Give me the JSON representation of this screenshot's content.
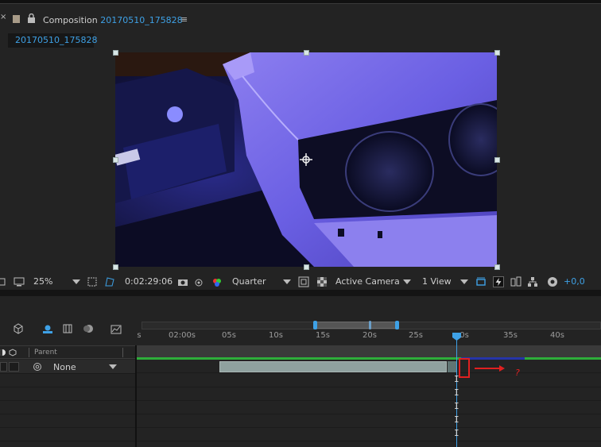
{
  "composition_panel": {
    "close_glyph": "×",
    "lock_icon": "lock-icon",
    "title_prefix": "Composition",
    "comp_name": "20170510_175828",
    "menu_glyph": "≡",
    "tab_label": "20170510_175828"
  },
  "viewer_toolbar": {
    "zoom": "25%",
    "timecode": "0:02:29:06",
    "resolution": "Quarter",
    "camera": "Active Camera",
    "view_layout": "1 View",
    "exposure": "+0,0",
    "icons": [
      "monitor-icon",
      "region-icon",
      "mask-visibility-icon",
      "snapshot-icon",
      "show-snapshot-icon",
      "color-channel-icon",
      "toggle-mask-icon",
      "transparency-grid-icon",
      "3d-draft-icon",
      "fast-preview-icon",
      "flowchart-icon",
      "timeline-icon",
      "reset-exposure-icon"
    ]
  },
  "timeline": {
    "ruler_labels": [
      "s",
      "02:00s",
      "05s",
      "10s",
      "15s",
      "20s",
      "25s",
      "0s",
      "35s",
      "40s"
    ],
    "column_header_parent": "Parent",
    "layer_parent_value": "None",
    "annotation_mark": "?"
  },
  "colors": {
    "accent": "#3ea1e6",
    "annotation": "#e02020",
    "layer_bar": "#8fa19f",
    "green_bar": "#2eae3a"
  }
}
